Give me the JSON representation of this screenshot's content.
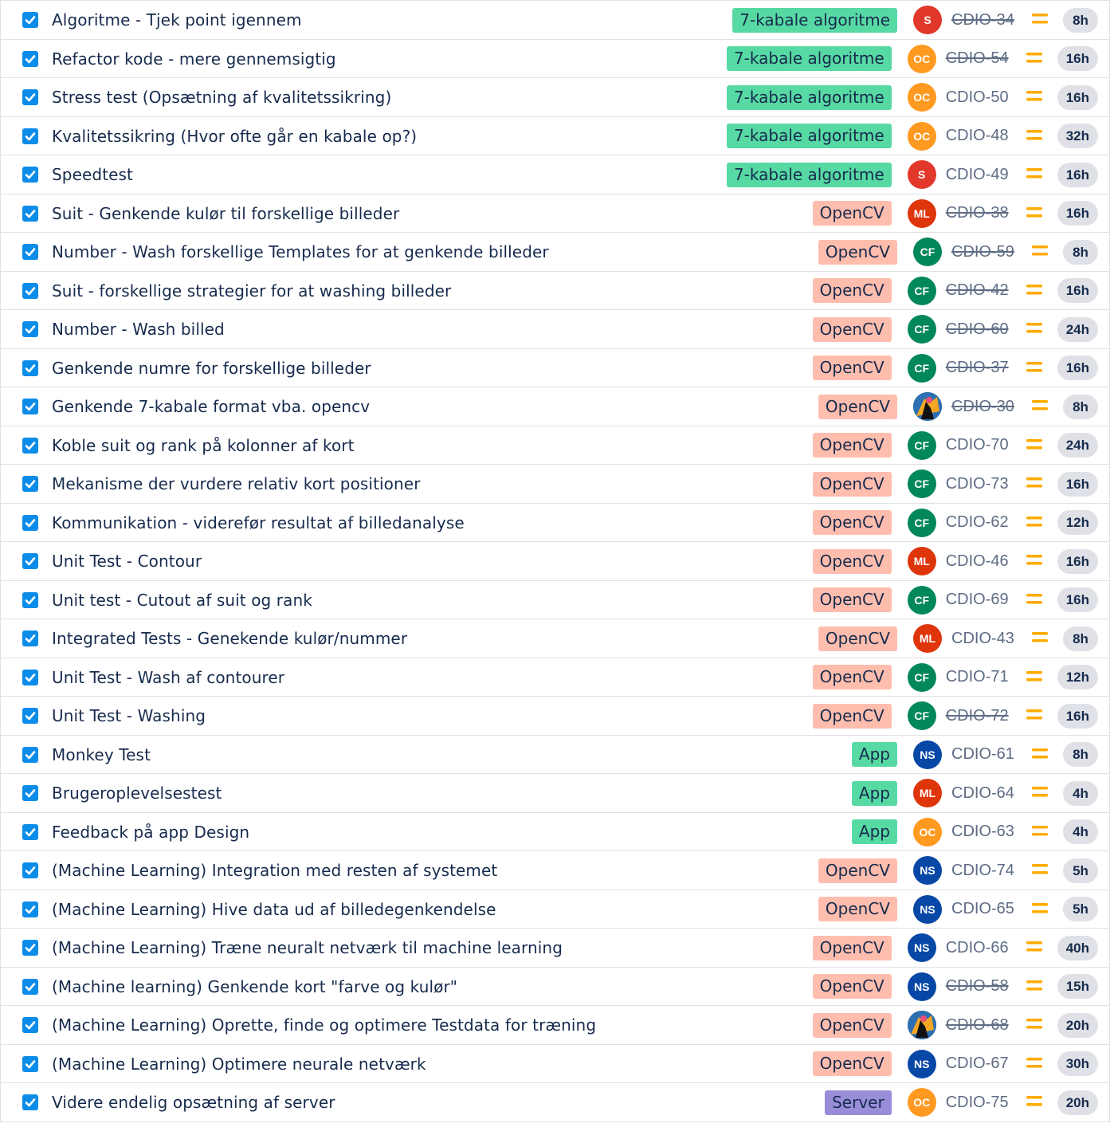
{
  "colors": {
    "epic_7kabale": "#57d9a3",
    "epic_opencv": "#ffbdad",
    "epic_app": "#57d9a3",
    "epic_server": "#998dd9",
    "avatar_S": "#e2372b",
    "avatar_OC": "#ff991f",
    "avatar_ML": "#de350b",
    "avatar_CF": "#00875a",
    "avatar_NS": "#0747a6",
    "priority_medium": "#ffab00",
    "checkbox": "#0c8ce9"
  },
  "issues": [
    {
      "summary": "Algoritme - Tjek point igennem",
      "epic": "7-kabale algoritme",
      "epic_color": "#57d9a3",
      "assignee": "S",
      "key": "CDIO-34",
      "done": true,
      "estimate": "8h"
    },
    {
      "summary": "Refactor kode - mere gennemsigtig",
      "epic": "7-kabale algoritme",
      "epic_color": "#57d9a3",
      "assignee": "OC",
      "key": "CDIO-54",
      "done": true,
      "estimate": "16h"
    },
    {
      "summary": "Stress test (Opsætning af kvalitetssikring)",
      "epic": "7-kabale algoritme",
      "epic_color": "#57d9a3",
      "assignee": "OC",
      "key": "CDIO-50",
      "done": false,
      "estimate": "16h"
    },
    {
      "summary": "Kvalitetssikring (Hvor ofte går en kabale op?)",
      "epic": "7-kabale algoritme",
      "epic_color": "#57d9a3",
      "assignee": "OC",
      "key": "CDIO-48",
      "done": false,
      "estimate": "32h"
    },
    {
      "summary": "Speedtest",
      "epic": "7-kabale algoritme",
      "epic_color": "#57d9a3",
      "assignee": "S",
      "key": "CDIO-49",
      "done": false,
      "estimate": "16h"
    },
    {
      "summary": "Suit - Genkende kulør til forskellige billeder",
      "epic": "OpenCV",
      "epic_color": "#ffbdad",
      "assignee": "ML",
      "key": "CDIO-38",
      "done": true,
      "estimate": "16h"
    },
    {
      "summary": "Number - Wash forskellige Templates for at genkende billeder",
      "epic": "OpenCV",
      "epic_color": "#ffbdad",
      "assignee": "CF",
      "key": "CDIO-59",
      "done": true,
      "estimate": "8h"
    },
    {
      "summary": "Suit - forskellige strategier for at washing billeder",
      "epic": "OpenCV",
      "epic_color": "#ffbdad",
      "assignee": "CF",
      "key": "CDIO-42",
      "done": true,
      "estimate": "16h"
    },
    {
      "summary": "Number - Wash billed",
      "epic": "OpenCV",
      "epic_color": "#ffbdad",
      "assignee": "CF",
      "key": "CDIO-60",
      "done": true,
      "estimate": "24h"
    },
    {
      "summary": "Genkende numre for forskellige billeder",
      "epic": "OpenCV",
      "epic_color": "#ffbdad",
      "assignee": "CF",
      "key": "CDIO-37",
      "done": true,
      "estimate": "16h"
    },
    {
      "summary": "Genkende 7-kabale format vba. opencv",
      "epic": "OpenCV",
      "epic_color": "#ffbdad",
      "assignee": "photo",
      "key": "CDIO-30",
      "done": true,
      "estimate": "8h"
    },
    {
      "summary": "Koble suit og rank på kolonner af kort",
      "epic": "OpenCV",
      "epic_color": "#ffbdad",
      "assignee": "CF",
      "key": "CDIO-70",
      "done": false,
      "estimate": "24h"
    },
    {
      "summary": "Mekanisme der vurdere relativ kort positioner",
      "epic": "OpenCV",
      "epic_color": "#ffbdad",
      "assignee": "CF",
      "key": "CDIO-73",
      "done": false,
      "estimate": "16h"
    },
    {
      "summary": "Kommunikation - viderefør resultat af billedanalyse",
      "epic": "OpenCV",
      "epic_color": "#ffbdad",
      "assignee": "CF",
      "key": "CDIO-62",
      "done": false,
      "estimate": "12h"
    },
    {
      "summary": "Unit Test - Contour",
      "epic": "OpenCV",
      "epic_color": "#ffbdad",
      "assignee": "ML",
      "key": "CDIO-46",
      "done": false,
      "estimate": "16h"
    },
    {
      "summary": "Unit test - Cutout af suit og rank",
      "epic": "OpenCV",
      "epic_color": "#ffbdad",
      "assignee": "CF",
      "key": "CDIO-69",
      "done": false,
      "estimate": "16h"
    },
    {
      "summary": "Integrated Tests - Genekende kulør/nummer",
      "epic": "OpenCV",
      "epic_color": "#ffbdad",
      "assignee": "ML",
      "key": "CDIO-43",
      "done": false,
      "estimate": "8h"
    },
    {
      "summary": "Unit Test - Wash af contourer",
      "epic": "OpenCV",
      "epic_color": "#ffbdad",
      "assignee": "CF",
      "key": "CDIO-71",
      "done": false,
      "estimate": "12h"
    },
    {
      "summary": "Unit Test - Washing",
      "epic": "OpenCV",
      "epic_color": "#ffbdad",
      "assignee": "CF",
      "key": "CDIO-72",
      "done": true,
      "estimate": "16h"
    },
    {
      "summary": "Monkey Test",
      "epic": "App",
      "epic_color": "#57d9a3",
      "assignee": "NS",
      "key": "CDIO-61",
      "done": false,
      "estimate": "8h"
    },
    {
      "summary": "Brugeroplevelsestest",
      "epic": "App",
      "epic_color": "#57d9a3",
      "assignee": "ML",
      "key": "CDIO-64",
      "done": false,
      "estimate": "4h"
    },
    {
      "summary": "Feedback på app Design",
      "epic": "App",
      "epic_color": "#57d9a3",
      "assignee": "OC",
      "key": "CDIO-63",
      "done": false,
      "estimate": "4h"
    },
    {
      "summary": "(Machine Learning) Integration med resten af systemet",
      "epic": "OpenCV",
      "epic_color": "#ffbdad",
      "assignee": "NS",
      "key": "CDIO-74",
      "done": false,
      "estimate": "5h"
    },
    {
      "summary": "(Machine Learning) Hive data ud af billedegenkendelse",
      "epic": "OpenCV",
      "epic_color": "#ffbdad",
      "assignee": "NS",
      "key": "CDIO-65",
      "done": false,
      "estimate": "5h"
    },
    {
      "summary": "(Machine Learning) Træne neuralt netværk til machine learning",
      "epic": "OpenCV",
      "epic_color": "#ffbdad",
      "assignee": "NS",
      "key": "CDIO-66",
      "done": false,
      "estimate": "40h"
    },
    {
      "summary": "(Machine learning) Genkende kort \"farve og kulør\"",
      "epic": "OpenCV",
      "epic_color": "#ffbdad",
      "assignee": "NS",
      "key": "CDIO-58",
      "done": true,
      "estimate": "15h"
    },
    {
      "summary": "(Machine Learning) Oprette, finde og optimere Testdata for træning",
      "epic": "OpenCV",
      "epic_color": "#ffbdad",
      "assignee": "photo",
      "key": "CDIO-68",
      "done": true,
      "estimate": "20h"
    },
    {
      "summary": "(Machine Learning) Optimere neurale netværk",
      "epic": "OpenCV",
      "epic_color": "#ffbdad",
      "assignee": "NS",
      "key": "CDIO-67",
      "done": false,
      "estimate": "30h"
    },
    {
      "summary": "Videre endelig opsætning af server",
      "epic": "Server",
      "epic_color": "#998dd9",
      "assignee": "OC",
      "key": "CDIO-75",
      "done": false,
      "estimate": "20h"
    }
  ]
}
